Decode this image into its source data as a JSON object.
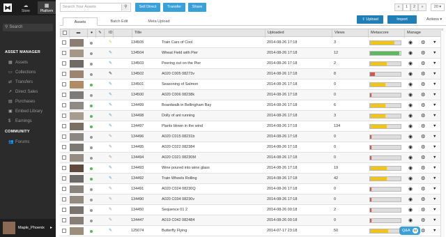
{
  "sidebar": {
    "store_label": "Store",
    "platform_label": "Platform",
    "search_label": "Search",
    "asset_manager_title": "ASSET MANAGER",
    "items": [
      {
        "label": "Assets",
        "icon": "film-icon"
      },
      {
        "label": "Collections",
        "icon": "folder-icon"
      },
      {
        "label": "Transfers",
        "icon": "transfer-icon"
      },
      {
        "label": "Direct Sales",
        "icon": "direct-sales-icon"
      },
      {
        "label": "Purchases",
        "icon": "purchases-icon"
      },
      {
        "label": "Embed Library",
        "icon": "embed-icon"
      },
      {
        "label": "Earnings",
        "icon": "dollar-icon"
      }
    ],
    "community_title": "COMMUNITY",
    "forums_label": "Forums",
    "user_name": "Maple_Phoenix"
  },
  "toolbar": {
    "search_placeholder": "Search Your Assets",
    "sell_direct": "Sell Direct",
    "transfer": "Transfer",
    "share": "Share",
    "page_prev": "«",
    "page_1": "1",
    "page_2": "2",
    "page_next": "»",
    "per_page": "20"
  },
  "tabs": [
    "Assets",
    "Batch Edit",
    "Meta Upload"
  ],
  "actions": {
    "upload": "Upload",
    "import": "Import",
    "actions": "Actions"
  },
  "columns": {
    "id": "ID",
    "title": "Title",
    "uploaded": "Uploaded",
    "views": "Views",
    "metascore": "Metascore",
    "manage": "Manage"
  },
  "qa": {
    "label": "Q&A",
    "count": "53"
  },
  "colors": {
    "yellow": "#f0c419",
    "green": "#5cb85c",
    "red": "#d9534f",
    "accent": "#3aa0d8"
  },
  "rows": [
    {
      "id": "134505",
      "title": "Train Cars of Cool",
      "uploaded": "2014-08-26 17:18",
      "views": "3",
      "score": 0.8,
      "scolor": "yellow",
      "status": "gray",
      "tag": "yellow",
      "thumb": "#8a7e72"
    },
    {
      "id": "134504",
      "title": "Wheat Field with Pier",
      "uploaded": "2014-08-26 17:18",
      "views": "12",
      "score": 0.95,
      "scolor": "green",
      "status": "gray",
      "tag": "blue",
      "thumb": "#a49785"
    },
    {
      "id": "134503",
      "title": "Peering out on the Pier",
      "uploaded": "2014-08-26 17:18",
      "views": "2",
      "score": 0.55,
      "scolor": "yellow",
      "status": "gray",
      "tag": "blue",
      "thumb": "#6f6a66"
    },
    {
      "id": "134502",
      "title": "A020 C005 08273v",
      "uploaded": "2014-08-26 17:18",
      "views": "8",
      "score": 0.15,
      "scolor": "red",
      "status": "gray",
      "tag": "black",
      "thumb": "#9c8570"
    },
    {
      "id": "134501",
      "title": "Seasoning of Salmon",
      "uploaded": "2014-08-26 17:18",
      "views": "0",
      "score": 0.5,
      "scolor": "yellow",
      "status": "green",
      "tag": "blue",
      "thumb": "#b08b66"
    },
    {
      "id": "134500",
      "title": "A020 C006 08238k",
      "uploaded": "2014-08-26 17:18",
      "views": "0",
      "score": 0.05,
      "scolor": "red",
      "status": "gray",
      "tag": "blue",
      "thumb": "#7d7a77"
    },
    {
      "id": "134499",
      "title": "Boardwalk in Bellingham Bay",
      "uploaded": "2014-08-26 17:18",
      "views": "6",
      "score": 0.5,
      "scolor": "yellow",
      "status": "green",
      "tag": "blue",
      "thumb": "#8f8a84"
    },
    {
      "id": "134498",
      "title": "Dolly of ant running",
      "uploaded": "2014-08-26 17:18",
      "views": "3",
      "score": 0.5,
      "scolor": "yellow",
      "status": "green",
      "tag": "blue",
      "thumb": "#a89c8f"
    },
    {
      "id": "134497",
      "title": "Plants blown in the wind",
      "uploaded": "2014-08-26 17:18",
      "views": "134",
      "score": 0.55,
      "scolor": "yellow",
      "status": "green",
      "tag": "blue",
      "thumb": "#7a6f63"
    },
    {
      "id": "134496",
      "title": "A020 C015 08231b",
      "uploaded": "2014-08-26 17:18",
      "views": "0",
      "score": 0.05,
      "scolor": "red",
      "status": "gray",
      "tag": "gray",
      "thumb": "#8e8680"
    },
    {
      "id": "134495",
      "title": "A020 C022 082384",
      "uploaded": "2014-08-26 17:18",
      "views": "0",
      "score": 0.05,
      "scolor": "red",
      "status": "gray",
      "tag": "gray",
      "thumb": "#7c7873"
    },
    {
      "id": "134494",
      "title": "A020 C021 08230M",
      "uploaded": "2014-08-26 17:18",
      "views": "0",
      "score": 0.05,
      "scolor": "red",
      "status": "gray",
      "tag": "gray",
      "thumb": "#968c82"
    },
    {
      "id": "134493",
      "title": "Wine poured into wine glass",
      "uploaded": "2014-08-26 17:18",
      "views": "19",
      "score": 0.55,
      "scolor": "yellow",
      "status": "green",
      "tag": "blue",
      "thumb": "#5f4a3c"
    },
    {
      "id": "134492",
      "title": "Train Wheels Rolling",
      "uploaded": "2014-08-26 17:18",
      "views": "42",
      "score": 0.55,
      "scolor": "yellow",
      "status": "green",
      "tag": "blue",
      "thumb": "#6d6a67"
    },
    {
      "id": "134491",
      "title": "A020 C024 08230Q",
      "uploaded": "2014-08-26 17:18",
      "views": "0",
      "score": 0.05,
      "scolor": "red",
      "status": "gray",
      "tag": "gray",
      "thumb": "#8a847d"
    },
    {
      "id": "134490",
      "title": "A020 C034 08230v",
      "uploaded": "2014-08-26 17:18",
      "views": "0",
      "score": 0.05,
      "scolor": "red",
      "status": "gray",
      "tag": "gray",
      "thumb": "#938a80"
    },
    {
      "id": "134450",
      "title": "Sequence 01 2",
      "uploaded": "2014-08-26 00:18",
      "views": "2",
      "score": 0.05,
      "scolor": "red",
      "status": "gray",
      "tag": "gray",
      "thumb": "#7a7470"
    },
    {
      "id": "134447",
      "title": "A019 C042 082484",
      "uploaded": "2014-08-26 00:18",
      "views": "0",
      "score": 0.05,
      "scolor": "red",
      "status": "gray",
      "tag": "gray",
      "thumb": "#877f77"
    },
    {
      "id": "125074",
      "title": "Butterfly Flying",
      "uploaded": "2014-07-17 23:18",
      "views": "50",
      "score": 0.6,
      "scolor": "yellow",
      "status": "green",
      "tag": "blue",
      "thumb": "#9b8e7a"
    }
  ]
}
